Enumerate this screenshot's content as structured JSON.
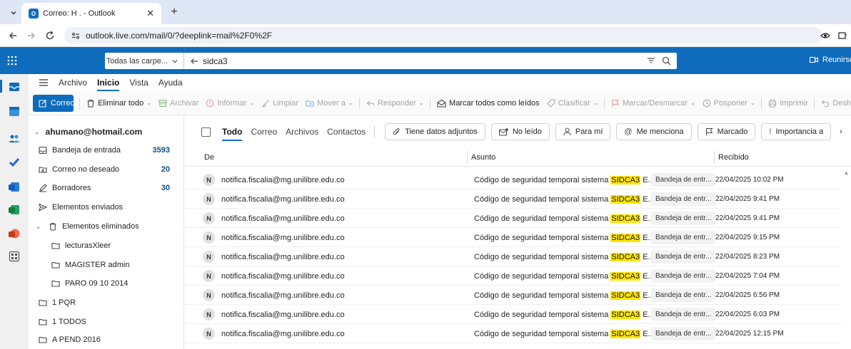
{
  "browser": {
    "tab_title": "Correo: H . - Outlook",
    "url": "outlook.live.com/mail/0/?deeplink=mail%2F0%2F"
  },
  "header": {
    "scope": "Todas las carpe...",
    "search_query": "sidca3",
    "meet_now": "Reunirse aho"
  },
  "ribbon": {
    "tabs": [
      "Archivo",
      "Inicio",
      "Vista",
      "Ayuda"
    ],
    "new_mail": "Correo nuevo",
    "actions": {
      "delete_all": "Eliminar todo",
      "archive": "Archivar",
      "report": "Informar",
      "sweep": "Limpiar",
      "move": "Mover a",
      "reply": "Responder",
      "mark_all_read": "Marcar todos como leídos",
      "categorize": "Clasificar",
      "flag": "Marcar/Desmarcar",
      "snooze": "Posponer",
      "print": "Imprimir",
      "undo": "Desh"
    }
  },
  "folders": {
    "account": "ahumano@hotmail.com",
    "items": [
      {
        "label": "Bandeja de entrada",
        "count": "3593",
        "icon": "inbox-icon"
      },
      {
        "label": "Correo no deseado",
        "count": "20",
        "icon": "junk-icon"
      },
      {
        "label": "Borradores",
        "count": "30",
        "icon": "drafts-icon"
      },
      {
        "label": "Elementos enviados",
        "count": "",
        "icon": "sent-icon"
      },
      {
        "label": "Elementos eliminados",
        "count": "",
        "icon": "trash-icon"
      },
      {
        "label": "lecturasXleer",
        "count": "",
        "icon": "folder-icon"
      },
      {
        "label": "MAGISTER admin",
        "count": "",
        "icon": "folder-icon"
      },
      {
        "label": "PARO 09 10 2014",
        "count": "",
        "icon": "folder-icon"
      },
      {
        "label": "1 PQR",
        "count": "",
        "icon": "folder-icon"
      },
      {
        "label": "1 TODOS",
        "count": "",
        "icon": "folder-icon"
      },
      {
        "label": "A PEND 2016",
        "count": "",
        "icon": "folder-icon"
      }
    ]
  },
  "filters": {
    "tabs": [
      "Todo",
      "Correo",
      "Archivos",
      "Contactos"
    ],
    "pills": [
      "Tiene datos adjuntos",
      "No leído",
      "Para mí",
      "Me menciona",
      "Marcado",
      "Importancia a"
    ]
  },
  "columns": {
    "from": "De",
    "subject": "Asunto",
    "received": "Recibido"
  },
  "messages": [
    {
      "avatar": "N",
      "from": "notifica.fiscalia@mg.unilibre.edu.co",
      "subject_pre": "Código de seguridad temporal sistema",
      "subject_hl": "SIDCA3",
      "subject_post": "E...",
      "folder": "Bandeja de entr...",
      "date": "22/04/2025 10:02 PM"
    },
    {
      "avatar": "N",
      "from": "notifica.fiscalia@mg.unilibre.edu.co",
      "subject_pre": "Código de seguridad temporal sistema",
      "subject_hl": "SIDCA3",
      "subject_post": "E...",
      "folder": "Bandeja de entr...",
      "date": "22/04/2025 9:41 PM"
    },
    {
      "avatar": "N",
      "from": "notifica.fiscalia@mg.unilibre.edu.co",
      "subject_pre": "Código de seguridad temporal sistema",
      "subject_hl": "SIDCA3",
      "subject_post": "E...",
      "folder": "Bandeja de entr...",
      "date": "22/04/2025 9:41 PM"
    },
    {
      "avatar": "N",
      "from": "notifica.fiscalia@mg.unilibre.edu.co",
      "subject_pre": "Código de seguridad temporal sistema",
      "subject_hl": "SIDCA3",
      "subject_post": "E...",
      "folder": "Bandeja de entr...",
      "date": "22/04/2025 9:15 PM"
    },
    {
      "avatar": "N",
      "from": "notifica.fiscalia@mg.unilibre.edu.co",
      "subject_pre": "Código de seguridad temporal sistema",
      "subject_hl": "SIDCA3",
      "subject_post": "E...",
      "folder": "Bandeja de entr...",
      "date": "22/04/2025 8:23 PM"
    },
    {
      "avatar": "N",
      "from": "notifica.fiscalia@mg.unilibre.edu.co",
      "subject_pre": "Código de seguridad temporal sistema",
      "subject_hl": "SIDCA3",
      "subject_post": "E...",
      "folder": "Bandeja de entr...",
      "date": "22/04/2025 7:04 PM"
    },
    {
      "avatar": "N",
      "from": "notifica.fiscalia@mg.unilibre.edu.co",
      "subject_pre": "Código de seguridad temporal sistema",
      "subject_hl": "SIDCA3",
      "subject_post": "E...",
      "folder": "Bandeja de entr...",
      "date": "22/04/2025 6:56 PM"
    },
    {
      "avatar": "N",
      "from": "notifica.fiscalia@mg.unilibre.edu.co",
      "subject_pre": "Código de seguridad temporal sistema",
      "subject_hl": "SIDCA3",
      "subject_post": "E...",
      "folder": "Bandeja de entr...",
      "date": "22/04/2025 6:03 PM"
    },
    {
      "avatar": "N",
      "from": "notifica.fiscalia@mg.unilibre.edu.co",
      "subject_pre": "Código de seguridad temporal sistema",
      "subject_hl": "SIDCA3",
      "subject_post": "E...",
      "folder": "Bandeja de entr...",
      "date": "22/04/2025 12:15 PM"
    }
  ],
  "colors": {
    "brand": "#0f6cbd",
    "highlight": "#ffe500",
    "tabstrip": "#dfe6f5"
  }
}
